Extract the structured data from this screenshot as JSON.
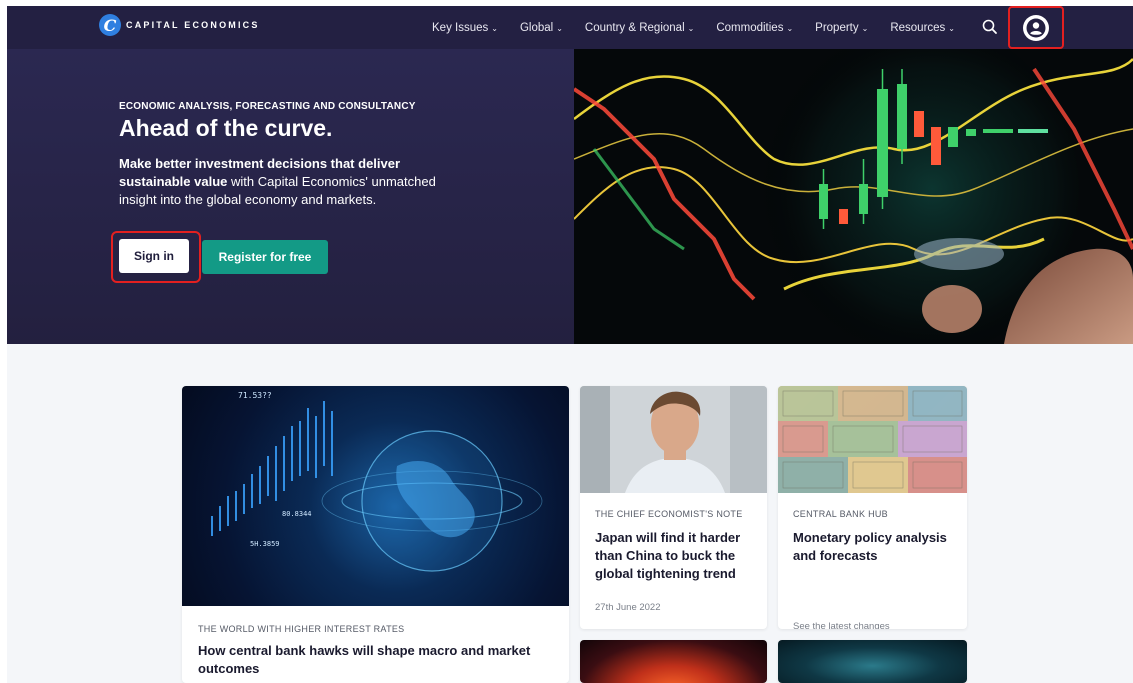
{
  "brand": {
    "logo_letter": "C",
    "name": "CAPITAL ECONOMICS"
  },
  "nav": {
    "items": [
      {
        "label": "Key Issues"
      },
      {
        "label": "Global"
      },
      {
        "label": "Country & Regional"
      },
      {
        "label": "Commodities"
      },
      {
        "label": "Property"
      },
      {
        "label": "Resources"
      }
    ],
    "chevron": "⌄"
  },
  "hero": {
    "eyebrow": "ECONOMIC ANALYSIS, FORECASTING AND CONSULTANCY",
    "title": "Ahead of the curve.",
    "desc_bold": "Make better investment decisions that deliver sustainable value",
    "desc_rest": " with Capital Economics' unmatched insight into the global economy and markets.",
    "signin_label": "Sign in",
    "register_label": "Register for free"
  },
  "cards": {
    "feature": {
      "tag": "THE WORLD WITH HIGHER INTEREST RATES",
      "title": "How central bank hawks will shape macro and market outcomes",
      "img_labels": [
        "71.53??",
        "80.8344",
        "5H.3859"
      ]
    },
    "economist": {
      "tag": "THE CHIEF ECONOMIST'S NOTE",
      "title": "Japan will find it harder than China to buck the global tightening trend",
      "date": "27th June 2022"
    },
    "central_bank": {
      "tag": "CENTRAL BANK HUB",
      "title": "Monetary policy analysis and forecasts",
      "meta": "See the latest changes"
    }
  },
  "colors": {
    "nav_bg": "#232042",
    "hero_bg": "#26234a",
    "accent_green": "#139a86",
    "highlight_red": "#e32020"
  }
}
